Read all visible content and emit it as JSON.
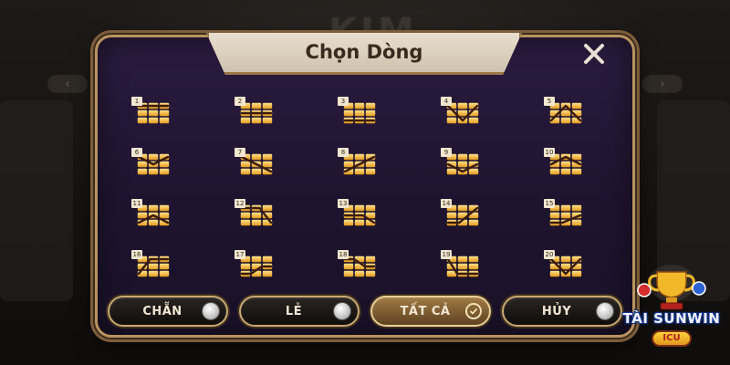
{
  "dialog": {
    "title": "Chọn Dòng",
    "close_icon": "close-icon"
  },
  "lines": [
    {
      "number": "1"
    },
    {
      "number": "2"
    },
    {
      "number": "3"
    },
    {
      "number": "4"
    },
    {
      "number": "5"
    },
    {
      "number": "6"
    },
    {
      "number": "7"
    },
    {
      "number": "8"
    },
    {
      "number": "9"
    },
    {
      "number": "10"
    },
    {
      "number": "11"
    },
    {
      "number": "12"
    },
    {
      "number": "13"
    },
    {
      "number": "14"
    },
    {
      "number": "15"
    },
    {
      "number": "16"
    },
    {
      "number": "17"
    },
    {
      "number": "18"
    },
    {
      "number": "19"
    },
    {
      "number": "20"
    }
  ],
  "buttons": {
    "even_label": "CHẴN",
    "odd_label": "LẺ",
    "all_label": "TẤT CẢ",
    "cancel_label": "HỦY"
  },
  "brand": {
    "name": "TÀI SUNWIN",
    "suffix": "ICU"
  },
  "colors": {
    "tile": "#f0b436",
    "line_stroke": "#3a1c0c",
    "accent_gold": "#c9a873",
    "panel": "#1f1430"
  }
}
